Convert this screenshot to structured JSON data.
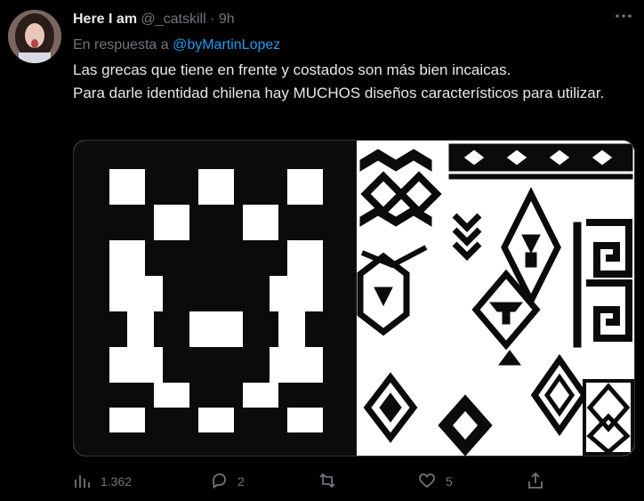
{
  "tweet": {
    "display_name": "Here I am",
    "handle": "@_catskill",
    "separator": "·",
    "time": "9h",
    "more_icon": "more-dots-icon",
    "reply_prefix": "En respuesta a",
    "reply_mention": "@byMartinLopez",
    "body_lines": [
      "Las grecas que tiene en frente y costados son más bien incaicas.",
      "Para darle identidad chilena hay MUCHOS diseños característicos para utilizar."
    ],
    "media": {
      "left_image": "andean-step-pattern",
      "right_image": "mapuche-designs-collection"
    },
    "actions": {
      "views": {
        "icon": "analytics-icon",
        "count": "1.362"
      },
      "reply": {
        "icon": "reply-icon",
        "count": "2"
      },
      "retweet": {
        "icon": "retweet-icon",
        "count": ""
      },
      "like": {
        "icon": "heart-icon",
        "count": "5"
      },
      "share": {
        "icon": "share-icon",
        "count": ""
      }
    }
  },
  "colors": {
    "background": "#000000",
    "text": "#e7e9ea",
    "muted": "#71767b",
    "accent": "#1d9bf0"
  }
}
